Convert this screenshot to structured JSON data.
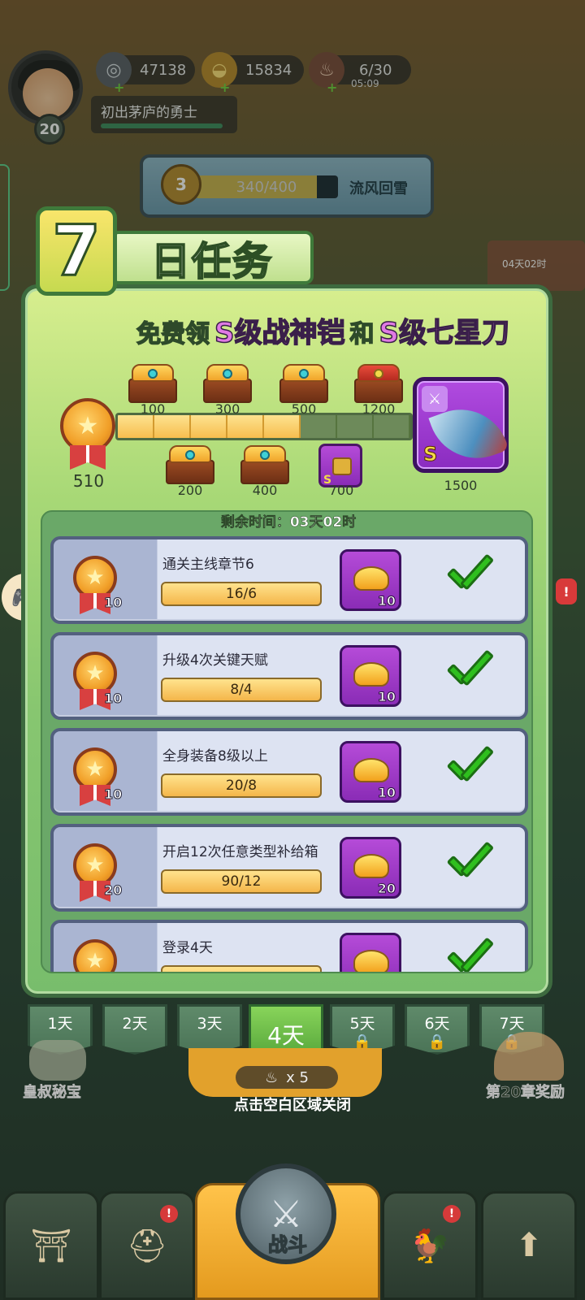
{
  "hud": {
    "player_level": "20",
    "player_title": "初出茅庐的勇士",
    "silver": "47138",
    "gold": "15834",
    "stamina": "6/30",
    "stamina_timer": "05:09",
    "stage_rank": "3",
    "stage_progress": "340/400",
    "stage_progress_fraction": 0.85,
    "stage_name": "流风回雪"
  },
  "side": {
    "right_timer": "04天02时",
    "alert": "!"
  },
  "panel": {
    "title_number": "7",
    "title_text": "日任务",
    "headline_prefix": "免费领",
    "headline_item1": "S级战神铠",
    "headline_and": "和",
    "headline_item2": "S级七星刀",
    "current_score": "510",
    "track_total_segments": 8,
    "track_filled_segments": 5,
    "milestones_top": [
      {
        "value": "100",
        "type": "chest"
      },
      {
        "value": "300",
        "type": "chest"
      },
      {
        "value": "500",
        "type": "chest"
      },
      {
        "value": "1200",
        "type": "red-chest"
      }
    ],
    "milestones_bottom": [
      {
        "value": "200",
        "type": "chest"
      },
      {
        "value": "400",
        "type": "chest"
      },
      {
        "value": "700",
        "type": "s-item"
      }
    ],
    "grand_reward_value": "1500",
    "grand_reward_grade": "S",
    "remaining_time": "剩余时间：03天02时"
  },
  "tasks": [
    {
      "name": "通关主线章节6",
      "progress": "16/6",
      "points": "10",
      "reward": "10",
      "completed": true
    },
    {
      "name": "升级4次关键天赋",
      "progress": "8/4",
      "points": "10",
      "reward": "10",
      "completed": true
    },
    {
      "name": "全身装备8级以上",
      "progress": "20/8",
      "points": "10",
      "reward": "10",
      "completed": true
    },
    {
      "name": "开启12次任意类型补给箱",
      "progress": "90/12",
      "points": "20",
      "reward": "20",
      "completed": true
    },
    {
      "name": "登录4天",
      "progress": "",
      "points": "",
      "reward": "",
      "completed": true
    }
  ],
  "days": [
    {
      "label": "1天",
      "locked": false,
      "active": false
    },
    {
      "label": "2天",
      "locked": false,
      "active": false
    },
    {
      "label": "3天",
      "locked": false,
      "active": false
    },
    {
      "label": "4天",
      "locked": false,
      "active": true
    },
    {
      "label": "5天",
      "locked": true,
      "active": false
    },
    {
      "label": "6天",
      "locked": true,
      "active": false
    },
    {
      "label": "7天",
      "locked": true,
      "active": false
    }
  ],
  "bottom": {
    "meat_count": "x 5",
    "close_hint": "点击空白区域关闭",
    "left_label": "皇叔秘宝",
    "right_label": "第20章奖励",
    "battle_label": "战斗"
  }
}
